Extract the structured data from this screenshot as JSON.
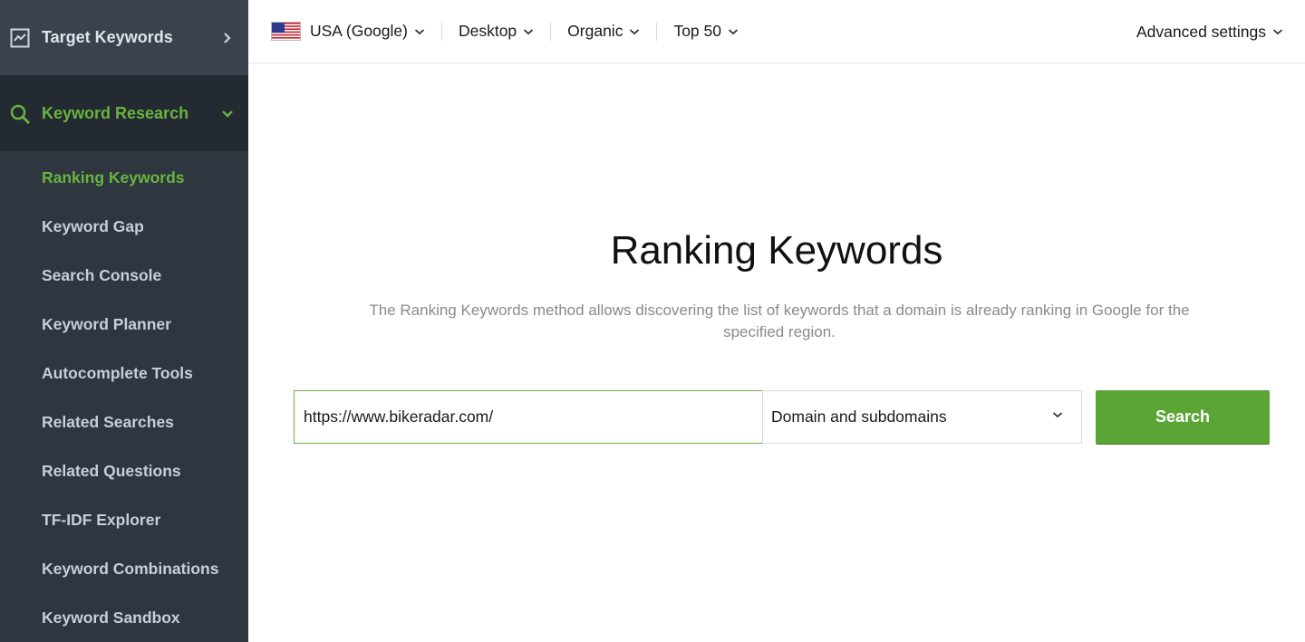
{
  "sidebar": {
    "sections": [
      {
        "label": "Target Keywords",
        "icon": "chart-line-icon",
        "expanded": false
      },
      {
        "label": "Keyword Research",
        "icon": "search-icon",
        "expanded": true
      }
    ],
    "items": [
      {
        "label": "Ranking Keywords",
        "active": true
      },
      {
        "label": "Keyword Gap"
      },
      {
        "label": "Search Console"
      },
      {
        "label": "Keyword Planner"
      },
      {
        "label": "Autocomplete Tools"
      },
      {
        "label": "Related Searches"
      },
      {
        "label": "Related Questions"
      },
      {
        "label": "TF-IDF Explorer"
      },
      {
        "label": "Keyword Combinations"
      },
      {
        "label": "Keyword Sandbox"
      }
    ]
  },
  "topbar": {
    "region": {
      "label": "USA (Google)",
      "icon": "us-flag-icon"
    },
    "device": "Desktop",
    "type": "Organic",
    "depth": "Top 50",
    "advanced": "Advanced settings"
  },
  "main": {
    "title": "Ranking Keywords",
    "description": "The Ranking Keywords method allows discovering the list of keywords that a domain is already ranking in Google for the specified region.",
    "url_value": "https://www.bikeradar.com/",
    "scope": "Domain and subdomains",
    "search_label": "Search"
  },
  "colors": {
    "accent": "#6ab43e",
    "button": "#5aa535",
    "sidebar_bg": "#2e3640",
    "sidebar_active_bg": "#232a32"
  }
}
